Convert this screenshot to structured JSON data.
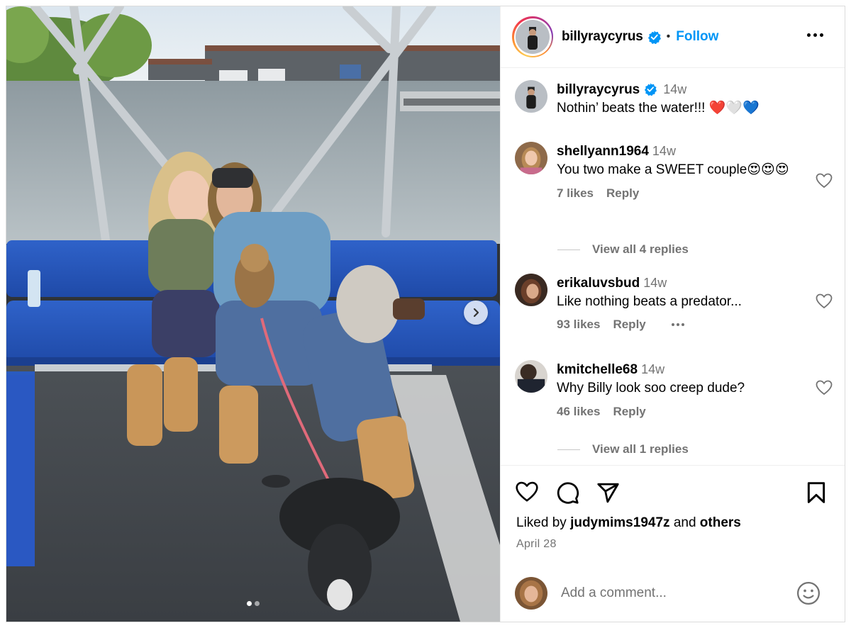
{
  "post": {
    "username": "billyraycyrus",
    "follow_label": "Follow",
    "separator": "•",
    "caption": {
      "username": "billyraycyrus",
      "time": "14w",
      "text": "Nothin’ beats the water!!! ❤️🤍💙"
    },
    "comments": [
      {
        "username": "shellyann1964",
        "time": "14w",
        "text": "You two make a SWEET couple😍😍😍",
        "likes": "7 likes",
        "reply_label": "Reply",
        "view_replies": "View all 4 replies"
      },
      {
        "username": "erikaluvsbud",
        "time": "14w",
        "text": "Like nothing beats a predator...",
        "likes": "93 likes",
        "reply_label": "Reply"
      },
      {
        "username": "kmitchelle68",
        "time": "14w",
        "text": "Why Billy look soo creep dude?",
        "likes": "46 likes",
        "reply_label": "Reply",
        "view_replies": "View all 1 replies"
      }
    ],
    "liked_by": {
      "prefix": "Liked by",
      "user": "judymims1947z",
      "middle": "and",
      "others": "others"
    },
    "date": "April 28",
    "add_comment_placeholder": "Add a comment...",
    "carousel": {
      "total": 2,
      "current": 1
    }
  },
  "icons": {
    "verified": "verified-badge-icon",
    "more": "more-options-icon",
    "like": "heart-icon",
    "comment": "comment-bubble-icon",
    "share": "paper-plane-icon",
    "save": "bookmark-icon",
    "emoji": "smiley-icon",
    "next": "chevron-right-icon"
  },
  "colors": {
    "follow": "#0095f6",
    "verified": "#0095f6",
    "muted": "#737373"
  }
}
